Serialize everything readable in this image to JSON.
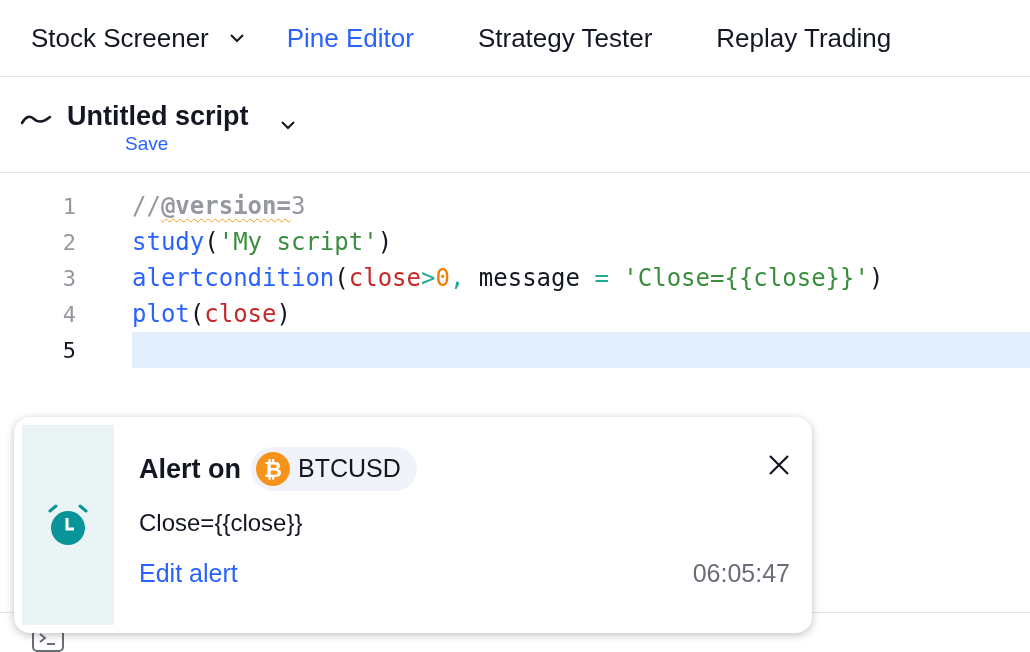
{
  "tabs": [
    {
      "label": "Stock Screener",
      "selected": false,
      "dropdown": true
    },
    {
      "label": "Pine Editor",
      "selected": true,
      "dropdown": false
    },
    {
      "label": "Strategy Tester",
      "selected": false,
      "dropdown": false
    },
    {
      "label": "Replay Trading",
      "selected": false,
      "dropdown": false
    }
  ],
  "script_header": {
    "title": "Untitled script",
    "save_label": "Save"
  },
  "editor": {
    "lines": [
      {
        "number": "1",
        "current": false,
        "tokens": [
          {
            "text": "//",
            "kind": "comment"
          },
          {
            "text": "@version=",
            "kind": "annotation"
          },
          {
            "text": "3",
            "kind": "comment"
          }
        ]
      },
      {
        "number": "2",
        "current": false,
        "tokens": [
          {
            "text": "study",
            "kind": "function"
          },
          {
            "text": "(",
            "kind": "plain"
          },
          {
            "text": "'My script'",
            "kind": "string"
          },
          {
            "text": ")",
            "kind": "plain"
          }
        ]
      },
      {
        "number": "3",
        "current": false,
        "tokens": [
          {
            "text": "alertcondition",
            "kind": "function"
          },
          {
            "text": "(",
            "kind": "plain"
          },
          {
            "text": "close",
            "kind": "variable"
          },
          {
            "text": ">",
            "kind": "operator"
          },
          {
            "text": "0",
            "kind": "number"
          },
          {
            "text": ",",
            "kind": "operator"
          },
          {
            "text": " message ",
            "kind": "plain"
          },
          {
            "text": "=",
            "kind": "operator"
          },
          {
            "text": " 'Close={{close}}'",
            "kind": "string"
          },
          {
            "text": ")",
            "kind": "plain"
          }
        ]
      },
      {
        "number": "4",
        "current": false,
        "tokens": [
          {
            "text": "plot",
            "kind": "function"
          },
          {
            "text": "(",
            "kind": "plain"
          },
          {
            "text": "close",
            "kind": "variable"
          },
          {
            "text": ")",
            "kind": "plain"
          }
        ]
      },
      {
        "number": "5",
        "current": true
      }
    ]
  },
  "alert": {
    "title": "Alert on",
    "symbol": "BTCUSD",
    "symbol_glyph": "₿",
    "message": "Close={{close}}",
    "link": "Edit alert",
    "time": "06:05:47"
  }
}
